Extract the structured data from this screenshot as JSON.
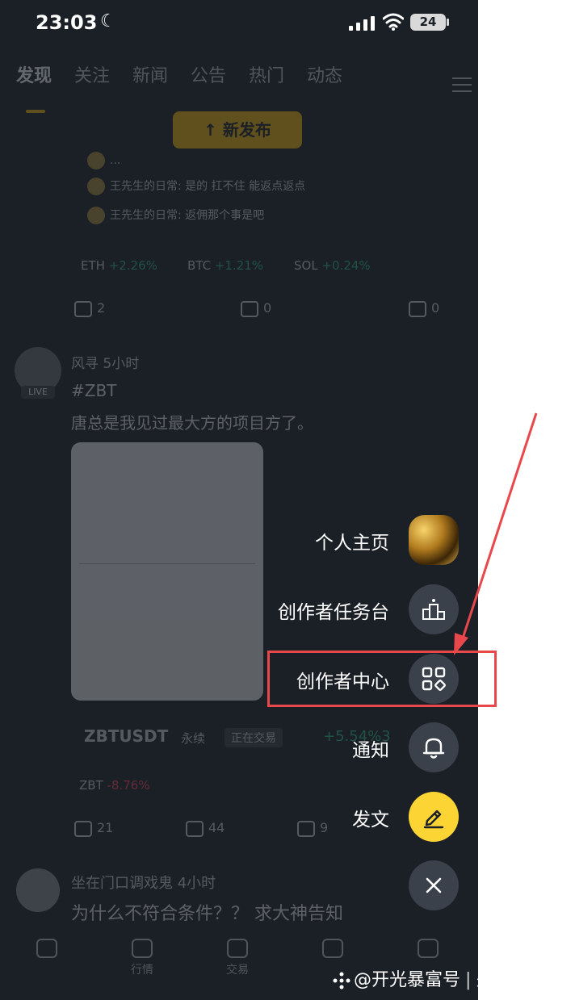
{
  "status_bar": {
    "time": "23:03",
    "battery": "24"
  },
  "feed": {
    "tabs": [
      "发现",
      "关注",
      "新闻",
      "公告",
      "热门",
      "动态"
    ],
    "new_post_label": "新发布",
    "comments": [
      "...",
      "王先生的日常: 是的 扛不住 能返点返点",
      "王先生的日常: 返佣那个事是吧"
    ],
    "tickers": [
      {
        "symbol": "ETH",
        "change": "+2.26%"
      },
      {
        "symbol": "BTC",
        "change": "+1.21%"
      },
      {
        "symbol": "SOL",
        "change": "+0.24%"
      }
    ],
    "stats1": {
      "likes": "2",
      "reposts": "0",
      "shares": "0"
    },
    "post": {
      "author": "风寻",
      "time": "5小时",
      "live": "LIVE",
      "tag": "#ZBT",
      "text": "唐总是我见过最大方的项目方了。"
    },
    "pair": {
      "symbol": "ZBTUSDT",
      "type": "永续",
      "status": "正在交易",
      "price": "+5.54%3",
      "change_symbol": "ZBT",
      "change": "-8.76%"
    },
    "stats2": {
      "comments": "21",
      "likes": "44",
      "reposts": "9"
    },
    "post2": {
      "author": "坐在门口调戏鬼",
      "time": "4小时",
      "text": "为什么不符合条件？？ 求大神告知"
    },
    "bottom_nav": [
      "行情",
      "交易"
    ]
  },
  "fab_menu": {
    "items": [
      {
        "label": "个人主页",
        "icon": "avatar-image"
      },
      {
        "label": "创作者任务台",
        "icon": "podium-icon"
      },
      {
        "label": "创作者中心",
        "icon": "grid-icon"
      },
      {
        "label": "通知",
        "icon": "bell-icon"
      },
      {
        "label": "发文",
        "icon": "pen-icon"
      }
    ],
    "close_icon": "close-icon",
    "accent_color": "#fcd535",
    "highlight_color": "#e8474c"
  },
  "watermark": {
    "handle": "@开光暴富号",
    "tagline": "关註必發"
  }
}
